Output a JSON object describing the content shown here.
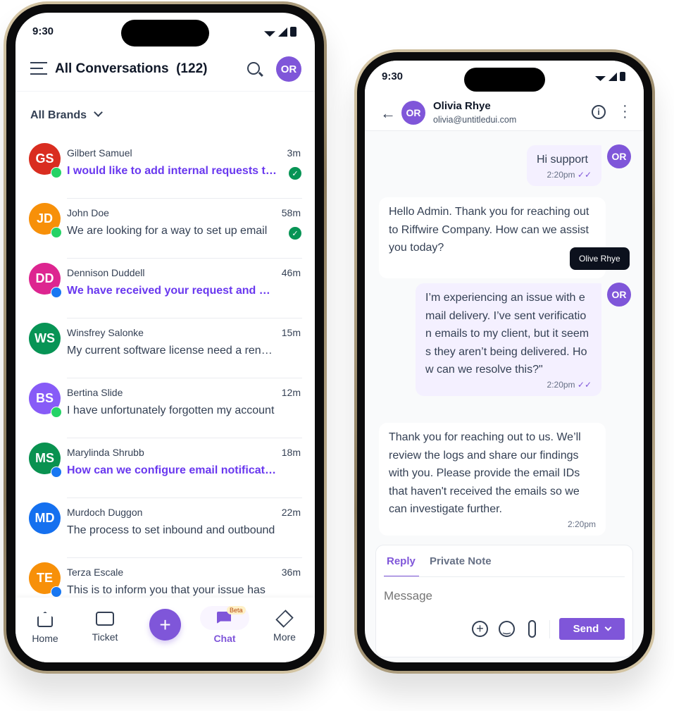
{
  "colors": {
    "accent": "#7f56d9",
    "unread": "#6938ef"
  },
  "left": {
    "status_time": "9:30",
    "header": {
      "title": "All Conversations",
      "count": "(122)",
      "avatar": "OR"
    },
    "filter": "All Brands",
    "conversations": [
      {
        "initials": "GS",
        "color": "#d92d20",
        "name": "Gilbert Samuel",
        "time": "3m",
        "preview": "I would like to add internal requests to the system",
        "unread": true,
        "channel": "whatsapp",
        "resolved": true
      },
      {
        "initials": "JD",
        "color": "#f79009",
        "name": "John Doe",
        "time": "58m",
        "preview": "We are looking for a way to set up email",
        "unread": false,
        "channel": "whatsapp",
        "resolved": true
      },
      {
        "initials": "DD",
        "color": "#dd2590",
        "name": "Dennison Duddell",
        "time": "46m",
        "preview": "We have received your request and our team",
        "unread": true,
        "channel": "facebook",
        "resolved": false
      },
      {
        "initials": "WS",
        "color": "#079455",
        "name": "Winsfrey Salonke",
        "time": "15m",
        "preview": "My current software license need a renewal",
        "unread": false,
        "channel": "",
        "resolved": false
      },
      {
        "initials": "BS",
        "color": "#875bf7",
        "name": "Bertina Slide",
        "time": "12m",
        "preview": "I have unfortunately forgotten my account",
        "unread": false,
        "channel": "whatsapp",
        "resolved": false
      },
      {
        "initials": "MS",
        "color": "#099250",
        "name": "Marylinda Shrubb",
        "time": "18m",
        "preview": "How can we configure email notifications",
        "unread": true,
        "channel": "facebook",
        "resolved": false
      },
      {
        "initials": "MD",
        "color": "#1570ef",
        "name": "Murdoch Duggon",
        "time": "22m",
        "preview": "The process to set inbound and outbound",
        "unread": false,
        "channel": "",
        "resolved": false
      },
      {
        "initials": "TE",
        "color": "#f79009",
        "name": "Terza Escale",
        "time": "36m",
        "preview": "This is to inform you that your issue has",
        "unread": false,
        "channel": "facebook",
        "resolved": false
      }
    ],
    "nav": {
      "home": "Home",
      "ticket": "Ticket",
      "chat": "Chat",
      "beta": "Beta",
      "more": "More"
    }
  },
  "right": {
    "status_time": "9:30",
    "contact": {
      "initials": "OR",
      "name": "Olivia Rhye",
      "email": "olivia@untitledui.com"
    },
    "messages": [
      {
        "text": "Hi support",
        "time": "2:20pm"
      },
      {
        "text": "Hello Admin. Thank you for reaching out to Riffwire Company. How can we assist you today?"
      },
      {
        "text": "I’m experiencing an issue with email delivery. I’ve sent verification emails to my client, but it seems they aren’t being delivered. How can we resolve this?\"",
        "time": "2:20pm"
      },
      {
        "text": "Thank you for reaching out to us. We’ll review the logs and share our findings with you. Please provide the email IDs that haven't received the emails so we can investigate further.",
        "time": "2:20pm"
      }
    ],
    "tooltip": "Olive Rhye",
    "composer": {
      "tab_reply": "Reply",
      "tab_note": "Private Note",
      "placeholder": "Message",
      "send": "Send"
    }
  }
}
